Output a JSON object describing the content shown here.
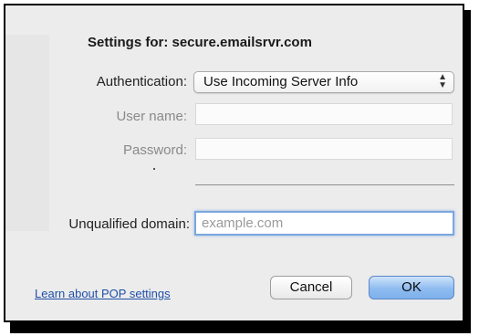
{
  "dialog": {
    "title": "Settings for: secure.emailsrvr.com",
    "authentication": {
      "label": "Authentication:",
      "selected": "Use Incoming Server Info"
    },
    "user_name": {
      "label": "User name:",
      "value": "",
      "enabled": false
    },
    "password": {
      "label": "Password:",
      "value": "",
      "enabled": false
    },
    "unqualified_domain": {
      "label": "Unqualified domain:",
      "value": "",
      "placeholder": "example.com"
    },
    "learn_link": "Learn about POP settings",
    "cancel_label": "Cancel",
    "ok_label": "OK"
  },
  "colors": {
    "sheet_background": "#ececec",
    "link": "#1f4fa8",
    "default_button": "#8fbcf0",
    "focus_ring": "#7aa7e0"
  }
}
